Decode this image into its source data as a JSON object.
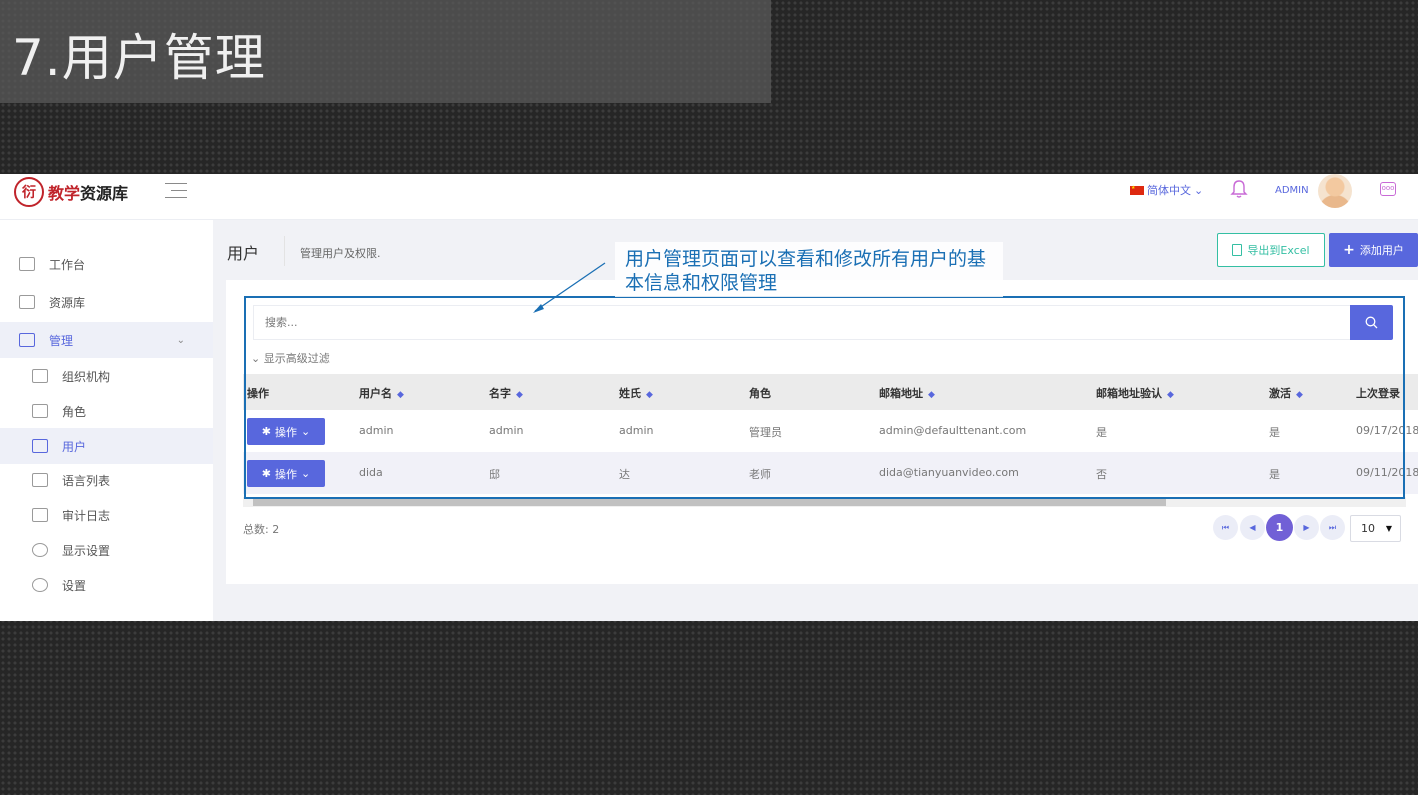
{
  "slide": {
    "title": "7.用户管理"
  },
  "app": {
    "logo_mark": "衍",
    "logo_name_red": "教学",
    "logo_name_rest": "资源库",
    "language": "简体中文",
    "user": "ADMIN",
    "chat_glyph": "ooo"
  },
  "sidebar": {
    "items": [
      {
        "label": "工作台",
        "level": "top"
      },
      {
        "label": "资源库",
        "level": "top"
      },
      {
        "label": "管理",
        "level": "top",
        "active": true
      },
      {
        "label": "组织机构",
        "level": "sub"
      },
      {
        "label": "角色",
        "level": "sub"
      },
      {
        "label": "用户",
        "level": "sub",
        "active": true
      },
      {
        "label": "语言列表",
        "level": "sub"
      },
      {
        "label": "审计日志",
        "level": "sub"
      },
      {
        "label": "显示设置",
        "level": "sub"
      },
      {
        "label": "设置",
        "level": "sub"
      }
    ]
  },
  "header": {
    "title": "用户",
    "subtitle": "管理用户及权限.",
    "export_label": "导出到Excel",
    "add_label": "添加用户"
  },
  "search": {
    "placeholder": "搜索...",
    "advanced_filter": "显示高级过滤"
  },
  "table": {
    "columns": [
      "操作",
      "用户名",
      "名字",
      "姓氏",
      "角色",
      "邮箱地址",
      "邮箱地址验认",
      "激活",
      "上次登录"
    ],
    "action_label": "操作",
    "rows": [
      [
        "admin",
        "admin",
        "admin",
        "管理员",
        "admin@defaulttenant.com",
        "是",
        "是",
        "09/17/2018"
      ],
      [
        "dida",
        "邸",
        "达",
        "老师",
        "dida@tianyuanvideo.com",
        "否",
        "是",
        "09/11/2018"
      ]
    ]
  },
  "footer": {
    "total": "总数: 2",
    "current_page": "1",
    "page_size": "10"
  },
  "callout": {
    "text": "用户管理页面可以查看和修改所有用户的基本信息和权限管理"
  },
  "colors": {
    "primary": "#5867dd",
    "accent_green": "#34bfa3",
    "callout_blue": "#1a6fb4",
    "brand_red": "#c0242b"
  }
}
